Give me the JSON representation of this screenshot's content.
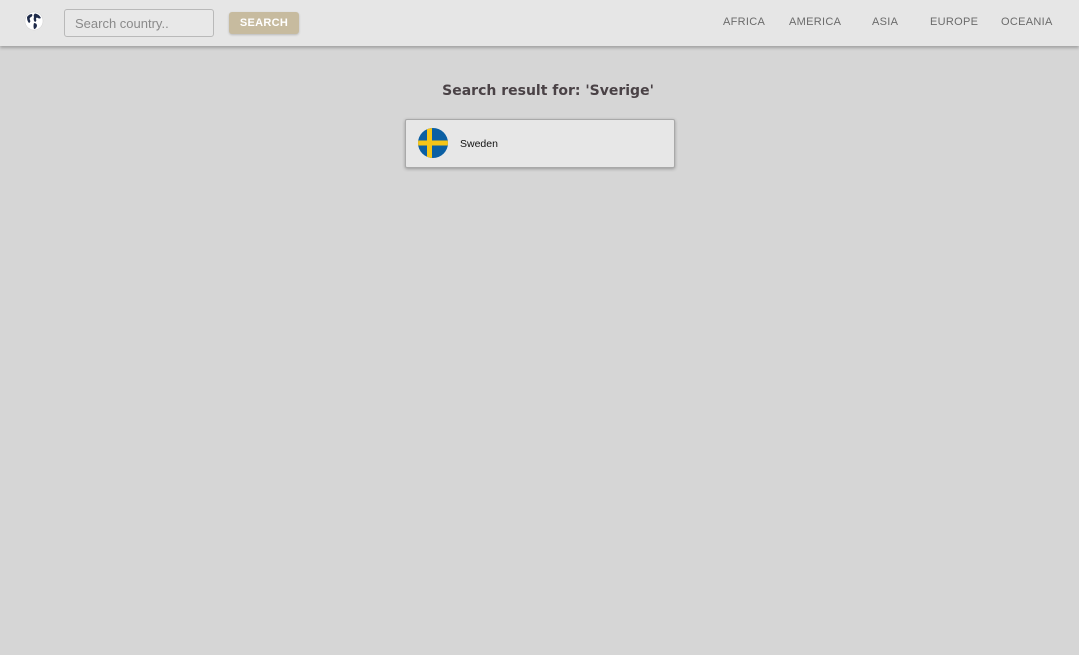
{
  "header": {
    "logo_icon": "globe-icon",
    "search": {
      "placeholder": "Search country..",
      "value": ""
    },
    "search_button_label": "SEARCH",
    "nav_links": [
      {
        "label": "AFRICA"
      },
      {
        "label": "AMERICA"
      },
      {
        "label": "ASIA"
      },
      {
        "label": "EUROPE"
      },
      {
        "label": "OCEANIA"
      }
    ]
  },
  "main": {
    "result_title": "Search result for: 'Sverige'",
    "results": [
      {
        "name": "Sweden",
        "flag_icon": "sweden-flag-icon",
        "flag_colors": {
          "blue": "#0b5fa3",
          "yellow": "#f5c518"
        }
      }
    ]
  },
  "colors": {
    "background": "#d6d6d6",
    "navbar": "#e6e6e6",
    "accent_button": "#c7bb9f"
  }
}
